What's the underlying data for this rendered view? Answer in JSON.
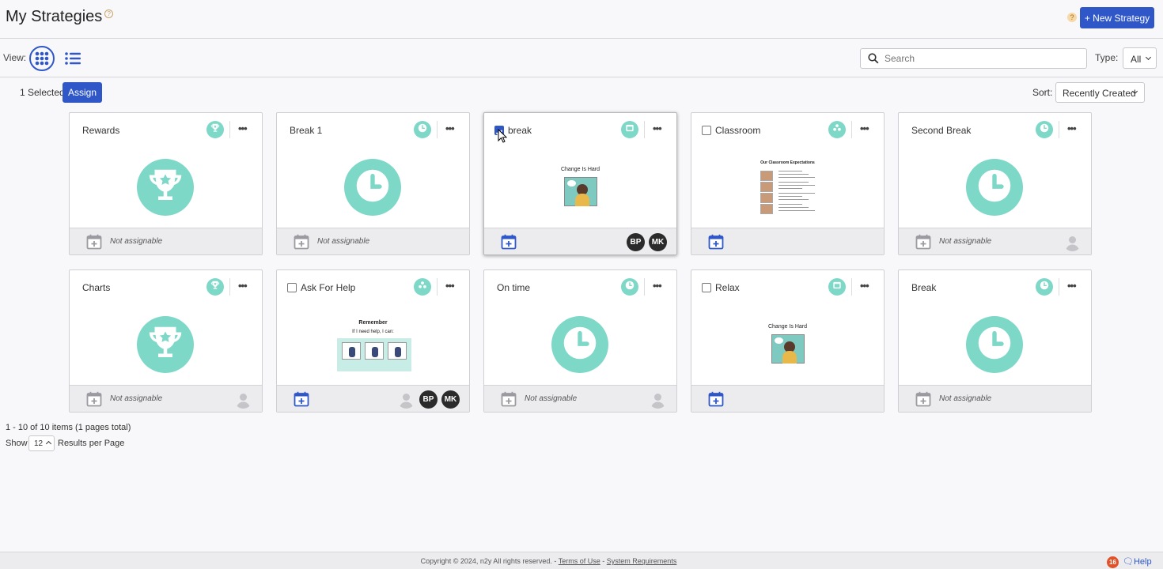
{
  "header": {
    "title": "My Strategies",
    "help_mark": "?",
    "new_button": "+ New Strategy"
  },
  "viewbar": {
    "view_label": "View:",
    "search_placeholder": "Search",
    "search_value": "",
    "type_label": "Type:",
    "type_value": "All"
  },
  "selection": {
    "count_text": "1 Selected",
    "assign_label": "Assign",
    "sort_label": "Sort:",
    "sort_value": "Recently Created"
  },
  "cards": [
    {
      "name": "Rewards",
      "type_icon": "trophy-icon",
      "footer": "Not assignable",
      "checked": false
    },
    {
      "name": "Break 1",
      "type_icon": "clock-icon",
      "footer": "Not assignable",
      "checked": false
    },
    {
      "name": "break",
      "type_icon": "image-icon",
      "footer": "",
      "checked": true,
      "thumb_caption": "Change Is Hard",
      "avatars": [
        "BP",
        "MK"
      ]
    },
    {
      "name": "Classroom",
      "type_icon": "group-icon",
      "footer": "",
      "checked": false,
      "thumb_caption": "Our Classroom Expectations"
    },
    {
      "name": "Second Break",
      "type_icon": "clock-icon",
      "footer": "Not assignable",
      "checked": false
    },
    {
      "name": "Charts",
      "type_icon": "trophy-icon",
      "footer": "Not assignable",
      "checked": false
    },
    {
      "name": "Ask For Help",
      "type_icon": "group-icon",
      "footer": "",
      "checked": false,
      "thumb_caption": "Remember",
      "thumb_sub": "If I need help, I can:",
      "avatars": [
        "BP",
        "MK"
      ]
    },
    {
      "name": "On time",
      "type_icon": "clock-icon",
      "footer": "Not assignable",
      "checked": false
    },
    {
      "name": "Relax",
      "type_icon": "image-icon",
      "footer": "",
      "checked": false,
      "thumb_caption": "Change Is Hard"
    },
    {
      "name": "Break",
      "type_icon": "clock-icon",
      "footer": "Not assignable",
      "checked": false
    }
  ],
  "pagination": {
    "summary": "1 - 10 of 10 items (1 pages total)",
    "show_label": "Show",
    "per_page": "12",
    "per_page_label": "Results per Page"
  },
  "footer": {
    "copyright": "Copyright © 2024, n2y All rights reserved. -",
    "terms": "Terms of Use",
    "dash": "-",
    "sysreq": "System Requirements",
    "help_count": "16",
    "help_label": "Help"
  },
  "colors": {
    "accent": "#2f57c8",
    "teal": "#7ed8c8",
    "badge": "#e0532a"
  }
}
